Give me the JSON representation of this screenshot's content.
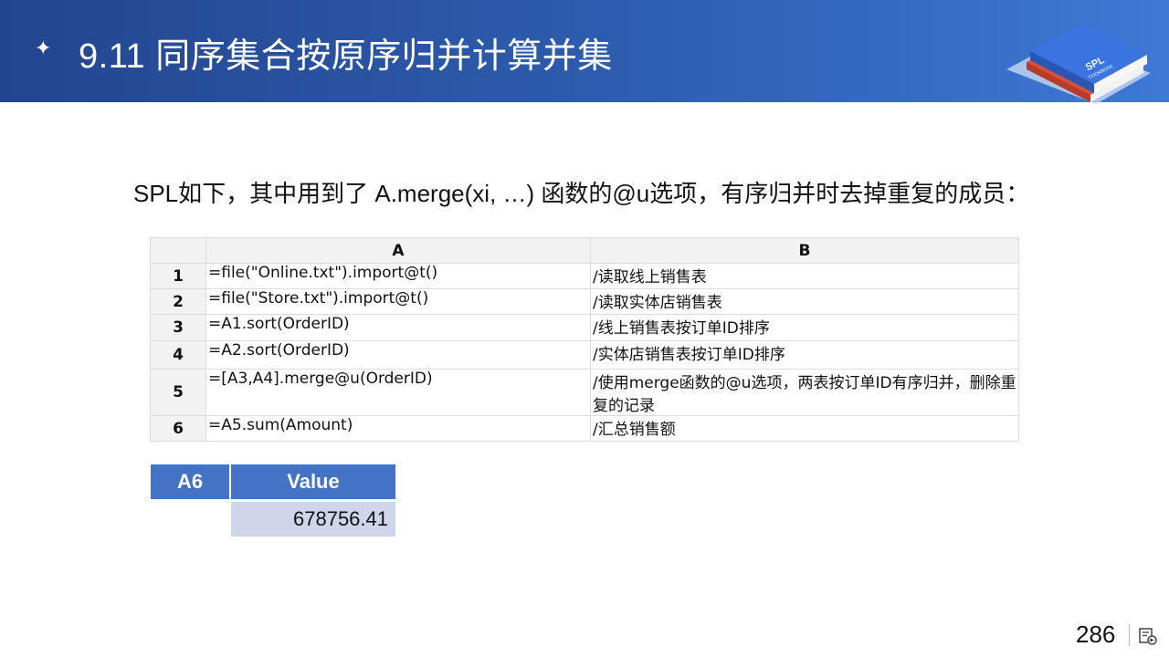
{
  "header": {
    "title": "9.11 同序集合按原序归并计算并集",
    "star": "✦"
  },
  "logo": {
    "text1": "SPL",
    "text2": "COOKBOOK"
  },
  "intro": "SPL如下，其中用到了 A.merge(xi, …) 函数的@u选项，有序归并时去掉重复的成员：",
  "grid": {
    "headers": [
      "A",
      "B"
    ],
    "rows": [
      {
        "num": "1",
        "a": "=file(\"Online.txt\").import@t()",
        "b": "/读取线上销售表"
      },
      {
        "num": "2",
        "a": "=file(\"Store.txt\").import@t()",
        "b": "/读取实体店销售表"
      },
      {
        "num": "3",
        "a": "=A1.sort(OrderID)",
        "b": "/线上销售表按订单ID排序"
      },
      {
        "num": "4",
        "a": "=A2.sort(OrderID)",
        "b": "/实体店销售表按订单ID排序"
      },
      {
        "num": "5",
        "a": "=[A3,A4].merge@u(OrderID)",
        "b": "/使用merge函数的@u选项，两表按订单ID有序归并，删除重复的记录"
      },
      {
        "num": "6",
        "a": "=A5.sum(Amount)",
        "b": "/汇总销售额"
      }
    ]
  },
  "result": {
    "col1": "A6",
    "col2": "Value",
    "value": "678756.41"
  },
  "page": {
    "number": "286"
  }
}
